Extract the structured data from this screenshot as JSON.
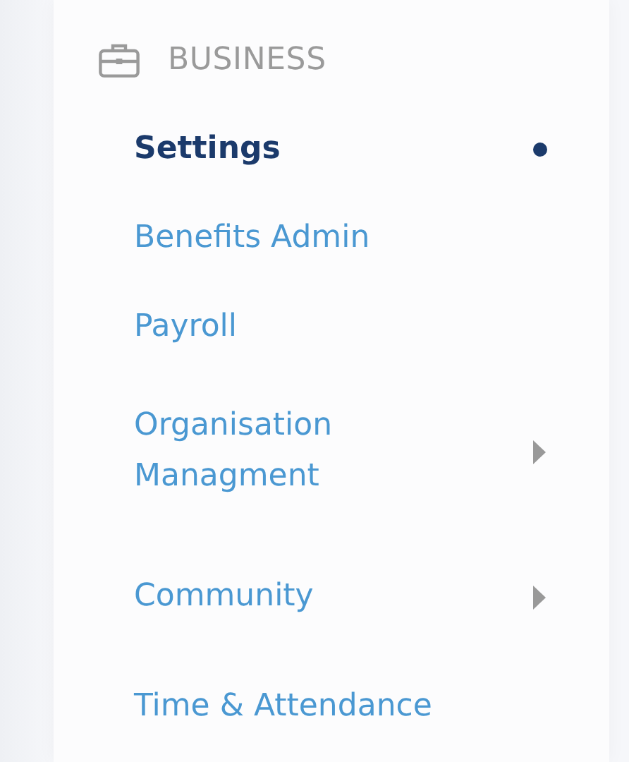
{
  "section": {
    "title": "BUSINESS"
  },
  "items": [
    {
      "label": "Settings",
      "selected": true,
      "expandable": false
    },
    {
      "label": "Benefits Admin",
      "selected": false,
      "expandable": false
    },
    {
      "label": "Payroll",
      "selected": false,
      "expandable": false
    },
    {
      "label": "Organisation Managment",
      "selected": false,
      "expandable": true
    },
    {
      "label": "Community",
      "selected": false,
      "expandable": true
    },
    {
      "label": "Time & Attendance",
      "selected": false,
      "expandable": false
    }
  ]
}
